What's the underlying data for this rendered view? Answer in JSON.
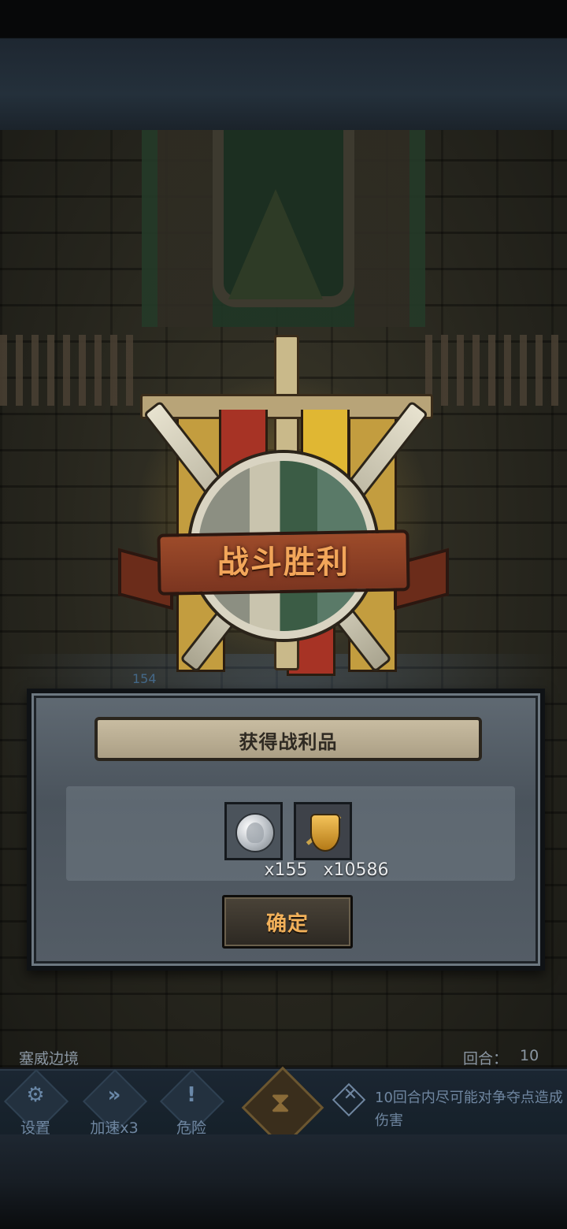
{
  "battle": {
    "result_title": "战斗胜利",
    "ghost_number": "154"
  },
  "loot_panel": {
    "header": "获得战利品",
    "items": [
      {
        "icon": "silver-coin-icon",
        "quantity": "x155"
      },
      {
        "icon": "golden-shield-badge-icon",
        "quantity": "x10586"
      }
    ],
    "confirm_label": "确定"
  },
  "hud": {
    "stage_name": "塞威边境",
    "round_label": "回合：",
    "round_value": "10",
    "buttons": {
      "settings": {
        "icon": "gear-icon",
        "glyph": "⚙",
        "label": "设置"
      },
      "speed": {
        "icon": "fast-forward-icon",
        "glyph": "»",
        "label": "加速x3"
      },
      "danger": {
        "icon": "exclamation-icon",
        "glyph": "!",
        "label": "危险"
      },
      "hourglass": {
        "icon": "hourglass-icon",
        "glyph": "⧗"
      }
    },
    "objective": {
      "icon": "crossed-swords-icon",
      "glyph": "✕",
      "text": "10回合内尽可能对争夺点造成伤害"
    }
  },
  "colors": {
    "title_orange": "#f2a65a",
    "confirm_orange": "#f2b15a",
    "hud_blue": "#6f86a0"
  }
}
